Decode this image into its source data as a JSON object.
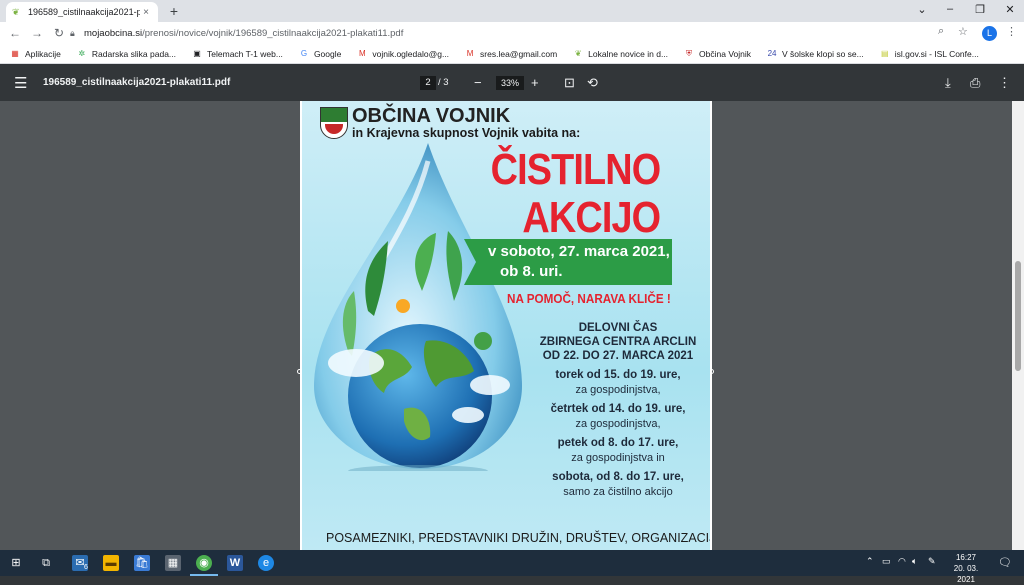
{
  "browser": {
    "tab_title": "196589_cistilnaakcija2021-plakat",
    "tab_close": "×",
    "new_tab": "+",
    "url_host": "mojaobcina.si",
    "url_path": "/prenosi/novice/vojnik/196589_cistilnaakcija2021-plakati11.pdf",
    "profile_initial": "L"
  },
  "bookmarks": [
    {
      "label": "Aplikacije",
      "icon": "apps-grid-icon",
      "color": "#d93025"
    },
    {
      "label": "Radarska slika pada...",
      "icon": "radar-icon",
      "color": "#34a853"
    },
    {
      "label": "Telemach T-1 web...",
      "icon": "telemach-icon",
      "color": "#202124"
    },
    {
      "label": "Google",
      "icon": "google-icon",
      "color": "#4285f4"
    },
    {
      "label": "vojnik.ogledalo@g...",
      "icon": "gmail-icon",
      "color": "#d93025"
    },
    {
      "label": "sres.lea@gmail.com",
      "icon": "gmail-icon",
      "color": "#d93025"
    },
    {
      "label": "Lokalne novice in d...",
      "icon": "leaf-icon",
      "color": "#7cb342"
    },
    {
      "label": "Občina Vojnik",
      "icon": "crest-icon",
      "color": "#c62828"
    },
    {
      "label": "V šolske klopi so se...",
      "icon": "24ur-icon",
      "color": "#3949ab"
    },
    {
      "label": "isl.gov.si - ISL Confe...",
      "icon": "isl-icon",
      "color": "#c0ca33"
    }
  ],
  "pdf": {
    "filename": "196589_cistilnaakcija2021-plakati11.pdf",
    "page_current": "2",
    "page_total": "/ 3",
    "zoom": "33%"
  },
  "poster": {
    "title": "OBČINA VOJNIK",
    "subtitle": "in Krajevna skupnost Vojnik vabita na:",
    "headline1": "ČISTILNO",
    "headline2": "AKCIJO",
    "date_line1": "v soboto, 27. marca 2021,",
    "date_line2": "ob 8. uri.",
    "slogan": "NA POMOČ, NARAVA KLIČE !",
    "hours_head1": "DELOVNI ČAS",
    "hours_head2": "ZBIRNEGA CENTRA ARCLIN",
    "hours_head3": "OD 22. DO 27. MARCA 2021",
    "schedule": [
      {
        "day": "torek od 15. do 19. ure,",
        "note": "za gospodinjstva,"
      },
      {
        "day": "četrtek od 14. do 19. ure,",
        "note": "za gospodinjstva,"
      },
      {
        "day": "petek od 8. do 17. ure,",
        "note": "za gospodinjstva in"
      },
      {
        "day": "sobota, od 8. do 17. ure,",
        "note": "samo za čistilno akcijo"
      }
    ],
    "footer": "POSAMEZNIKI, PREDSTAVNIKI DRUŽIN, DRUŠTEV, ORGANIZACIJ,"
  },
  "taskbar": {
    "time": "16:27",
    "date": "20. 03. 2021",
    "mail_badge": "6"
  },
  "colors": {
    "accent_red": "#e5232f",
    "banner_green": "#2c9c46",
    "pdf_bar": "#323639"
  }
}
